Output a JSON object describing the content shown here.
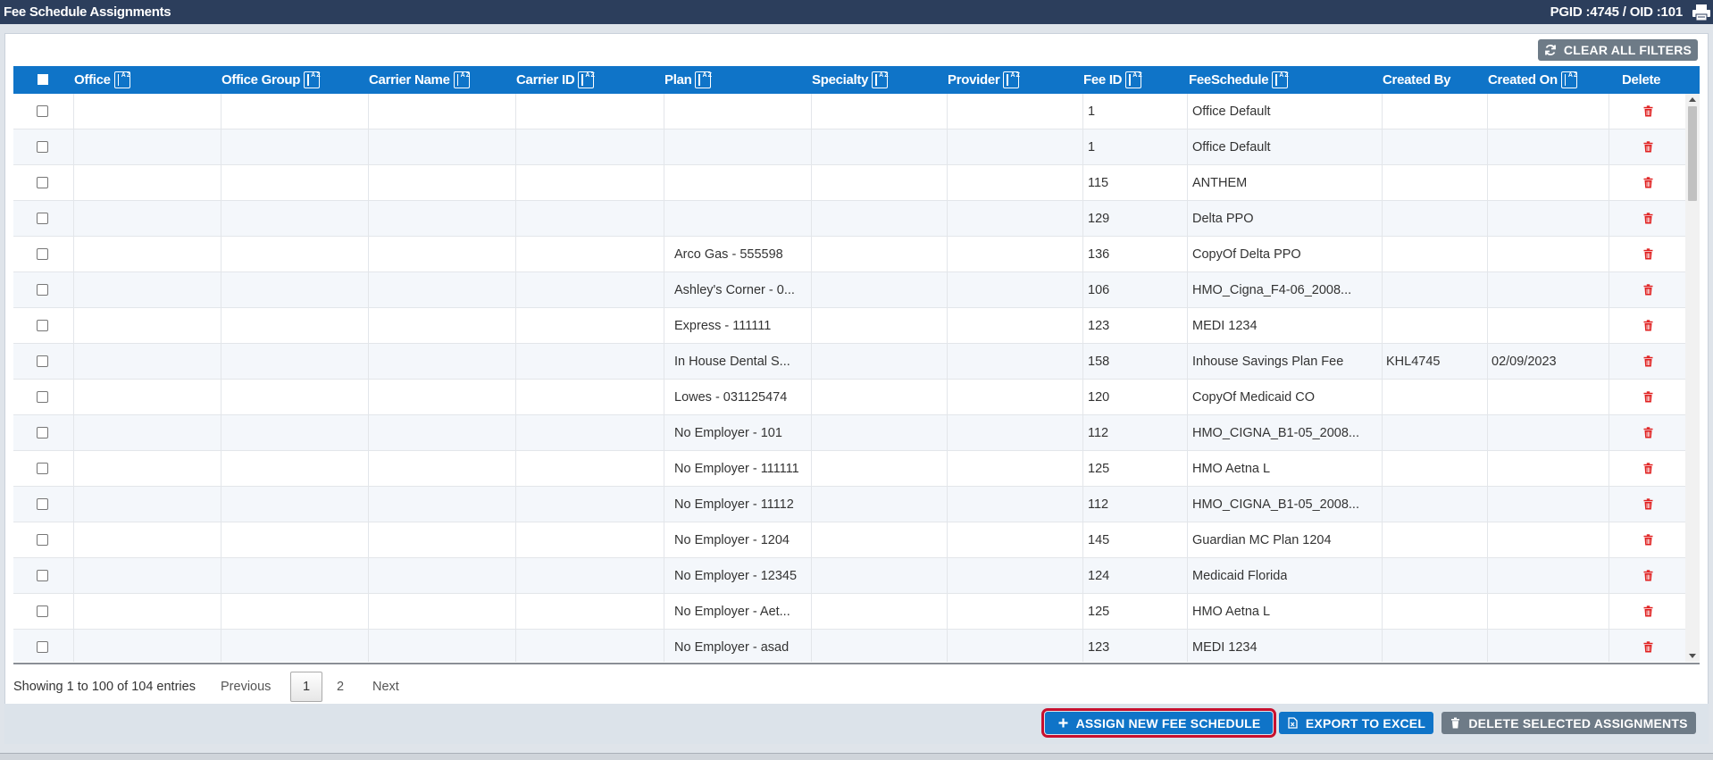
{
  "window": {
    "title": "Fee Schedule Assignments",
    "ids": "PGID :4745  /  OID :101"
  },
  "toolbar": {
    "clear_filters_label": "CLEAR ALL FILTERS"
  },
  "table": {
    "columns": [
      "Office",
      "Office Group",
      "Carrier Name",
      "Carrier ID",
      "Plan",
      "Specialty",
      "Provider",
      "Fee ID",
      "FeeSchedule",
      "Created By",
      "Created On",
      "Delete"
    ],
    "rows": [
      {
        "plan": "",
        "fee_id": "1",
        "fee_schedule": "Office Default",
        "created_by": "",
        "created_on": ""
      },
      {
        "plan": "",
        "fee_id": "1",
        "fee_schedule": "Office Default",
        "created_by": "",
        "created_on": ""
      },
      {
        "plan": "",
        "fee_id": "115",
        "fee_schedule": "ANTHEM",
        "created_by": "",
        "created_on": ""
      },
      {
        "plan": "",
        "fee_id": "129",
        "fee_schedule": "Delta PPO",
        "created_by": "",
        "created_on": ""
      },
      {
        "plan": "Arco Gas - 555598",
        "fee_id": "136",
        "fee_schedule": "CopyOf Delta PPO",
        "created_by": "",
        "created_on": ""
      },
      {
        "plan": "Ashley's Corner - 0...",
        "fee_id": "106",
        "fee_schedule": "HMO_Cigna_F4-06_2008...",
        "created_by": "",
        "created_on": ""
      },
      {
        "plan": "Express - 111111",
        "fee_id": "123",
        "fee_schedule": "MEDI 1234",
        "created_by": "",
        "created_on": ""
      },
      {
        "plan": "In House Dental S...",
        "fee_id": "158",
        "fee_schedule": "Inhouse Savings Plan Fee",
        "created_by": "KHL4745",
        "created_on": "02/09/2023"
      },
      {
        "plan": "Lowes - 031125474",
        "fee_id": "120",
        "fee_schedule": "CopyOf Medicaid CO",
        "created_by": "",
        "created_on": ""
      },
      {
        "plan": "No Employer - 101",
        "fee_id": "112",
        "fee_schedule": "HMO_CIGNA_B1-05_2008...",
        "created_by": "",
        "created_on": ""
      },
      {
        "plan": "No Employer - 111111",
        "fee_id": "125",
        "fee_schedule": "HMO Aetna L",
        "created_by": "",
        "created_on": ""
      },
      {
        "plan": "No Employer - 11112",
        "fee_id": "112",
        "fee_schedule": "HMO_CIGNA_B1-05_2008...",
        "created_by": "",
        "created_on": ""
      },
      {
        "plan": "No Employer - 1204",
        "fee_id": "145",
        "fee_schedule": "Guardian MC Plan 1204",
        "created_by": "",
        "created_on": ""
      },
      {
        "plan": "No Employer - 12345",
        "fee_id": "124",
        "fee_schedule": "Medicaid Florida",
        "created_by": "",
        "created_on": ""
      },
      {
        "plan": "No Employer - Aet...",
        "fee_id": "125",
        "fee_schedule": "HMO Aetna L",
        "created_by": "",
        "created_on": ""
      },
      {
        "plan": "No Employer - asad",
        "fee_id": "123",
        "fee_schedule": "MEDI 1234",
        "created_by": "",
        "created_on": ""
      }
    ]
  },
  "pager": {
    "info": "Showing 1 to 100 of 104 entries",
    "previous": "Previous",
    "current_page": "1",
    "page2": "2",
    "next": "Next"
  },
  "footer": {
    "assign_label": "ASSIGN NEW FEE SCHEDULE",
    "export_label": "EXPORT TO EXCEL",
    "delete_label": "DELETE SELECTED ASSIGNMENTS"
  },
  "colors": {
    "header_bar": "#2c3e5c",
    "grid_header": "#0f74c8",
    "delete_icon": "#e02020",
    "highlight_outline": "#c8102e"
  }
}
